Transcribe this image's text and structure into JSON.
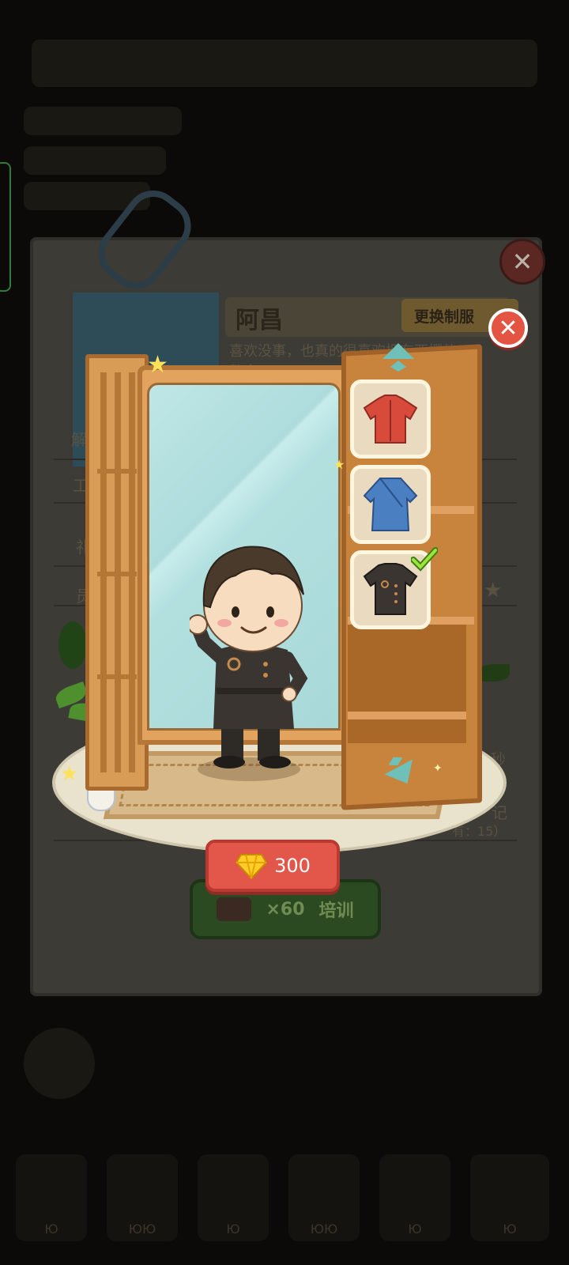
{
  "background": {
    "bottom_nav": [
      "Ю",
      "ЮЮ",
      "Ю",
      "ЮЮ",
      "Ю",
      "Ю"
    ]
  },
  "card": {
    "name": "阿昌",
    "uniform_button_label": "更换制服",
    "description": "喜欢没事，也真的很喜欢把东西摆放整齐...",
    "stat_left_1": "解",
    "stat_left_2": "工",
    "stat_left_3": "礼",
    "stat_left_4": "员",
    "stat_right_1": "秒",
    "stat_right_2": "记",
    "stat_count": "有：15）",
    "train_cost": "×60",
    "train_label": "培训"
  },
  "wardrobe": {
    "outfits": [
      {
        "name": "red-shirt-icon",
        "color": "#d84a3a",
        "selected": false
      },
      {
        "name": "blue-robe-icon",
        "color": "#4a7fc1",
        "selected": false
      },
      {
        "name": "black-uniform-icon",
        "color": "#3a3530",
        "selected": true
      }
    ],
    "price": "300",
    "accent": "#e2574a"
  }
}
